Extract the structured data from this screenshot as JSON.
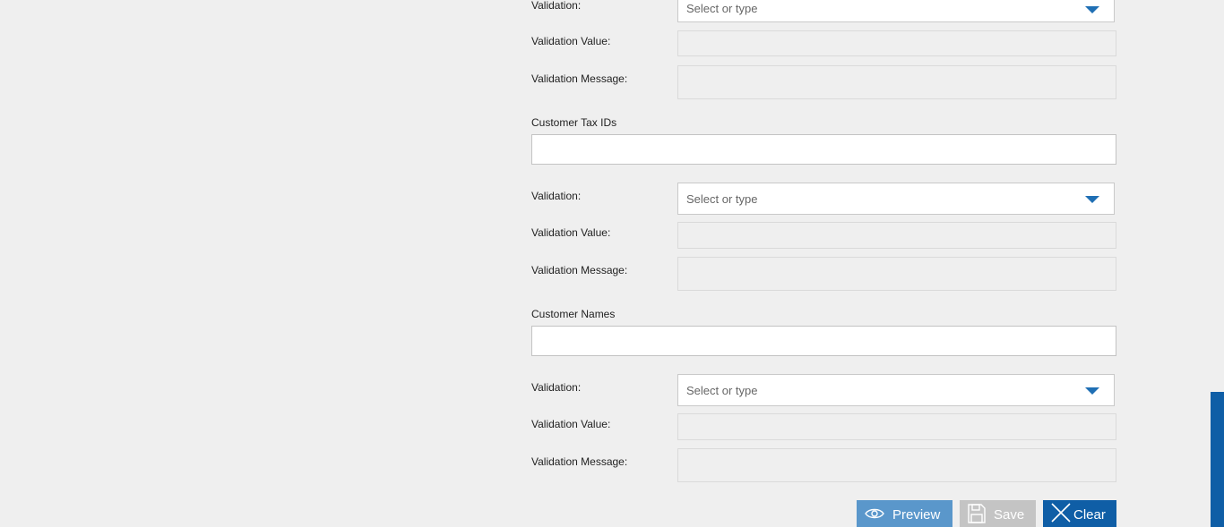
{
  "groups": [
    {
      "validation_label": "Validation:",
      "validation_placeholder": "Select or type",
      "validation_value_label": "Validation Value:",
      "validation_message_label": "Validation Message:"
    },
    {
      "section_label": "Customer Tax IDs",
      "validation_label": "Validation:",
      "validation_placeholder": "Select or type",
      "validation_value_label": "Validation Value:",
      "validation_message_label": "Validation Message:"
    },
    {
      "section_label": "Customer Names",
      "validation_label": "Validation:",
      "validation_placeholder": "Select or type",
      "validation_value_label": "Validation Value:",
      "validation_message_label": "Validation Message:"
    }
  ],
  "actions": {
    "preview_label": "Preview",
    "save_label": "Save",
    "clear_label": "Clear"
  },
  "icons": {
    "preview": "eye-icon",
    "save": "floppy-disk-icon",
    "clear": "close-icon",
    "dropdown": "chevron-down-icon"
  },
  "colors": {
    "accent": "#1f6fb4",
    "preview_button": "#5a97cb",
    "save_button_disabled": "#c4c4c4",
    "clear_button": "#0f5ea6"
  }
}
